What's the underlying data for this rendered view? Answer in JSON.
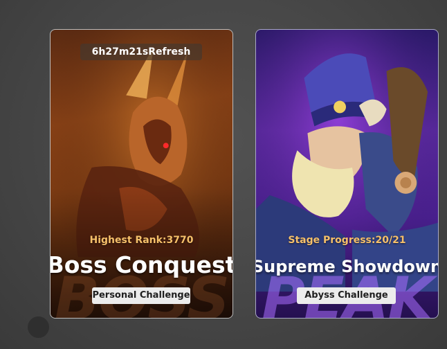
{
  "boss_card": {
    "refresh_timer": "6h27m21sRefresh",
    "stat_text": "Highest Rank:3770",
    "title": "Boss Conquest",
    "mode_label": "Personal Challenge",
    "background_word": "BOSS"
  },
  "peak_card": {
    "stat_text": "Stage Progress:20/21",
    "title": "Supreme Showdown",
    "mode_label": "Abyss Challenge",
    "background_word": "PEAK"
  },
  "colors": {
    "stat_text": "#f6c06a",
    "title_text": "#ffffff",
    "tag_background": "#ececec",
    "boss_theme": "#8a4216",
    "peak_theme": "#5a2aa0"
  }
}
